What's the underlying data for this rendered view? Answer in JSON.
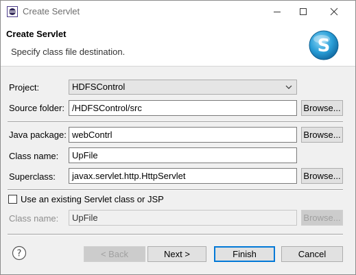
{
  "window": {
    "title": "Create Servlet",
    "controls": {
      "minimize_icon": "minimize-icon",
      "maximize_icon": "maximize-icon",
      "close_icon": "close-icon"
    }
  },
  "banner": {
    "title": "Create Servlet",
    "message": "Specify class file destination.",
    "logo_letter": "S",
    "logo_color": "#2a9fd8"
  },
  "form": {
    "project": {
      "label": "Project:",
      "value": "HDFSControl"
    },
    "source_folder": {
      "label": "Source folder:",
      "value": "/HDFSControl/src",
      "browse": "Browse..."
    },
    "java_package": {
      "label": "Java package:",
      "value": "webContrl",
      "browse": "Browse..."
    },
    "class_name": {
      "label": "Class name:",
      "value": "UpFile"
    },
    "superclass": {
      "label": "Superclass:",
      "value": "javax.servlet.http.HttpServlet",
      "browse": "Browse..."
    },
    "use_existing": {
      "label": "Use an existing Servlet class or JSP",
      "checked": false
    },
    "existing_class": {
      "label": "Class name:",
      "value": "UpFile",
      "browse": "Browse..."
    }
  },
  "footer": {
    "help_icon": "help-icon",
    "back": "< Back",
    "next": "Next >",
    "finish": "Finish",
    "cancel": "Cancel"
  }
}
